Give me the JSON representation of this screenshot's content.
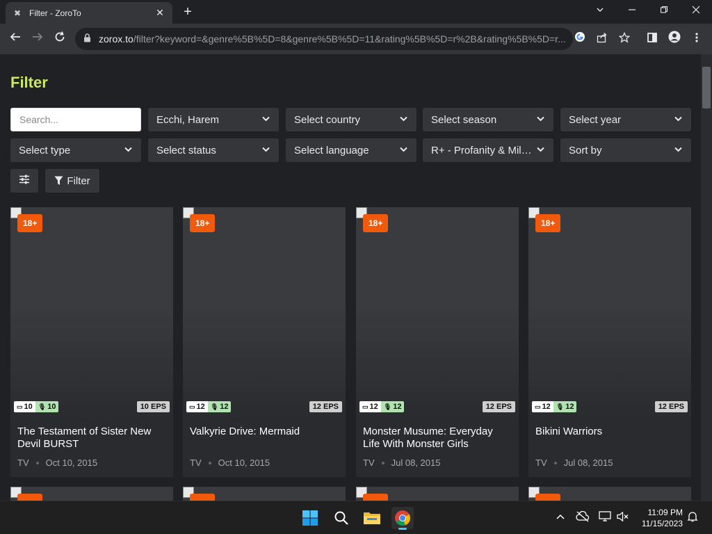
{
  "browser": {
    "tab_title": "Filter - ZoroTo",
    "tab_close": "✕",
    "new_tab": "+",
    "url_host": "zorox.to",
    "url_path": "/filter?keyword=&genre%5B%5D=8&genre%5B%5D=11&rating%5B%5D=r%2B&rating%5B%5D=r..."
  },
  "page": {
    "title": "Filter",
    "search_placeholder": "Search...",
    "filters_row1": [
      "Ecchi, Harem",
      "Select country",
      "Select season",
      "Select year"
    ],
    "filters_row2": [
      "Select type",
      "Select status",
      "Select language",
      "R+ - Profanity & Mild Nudity",
      "Sort by"
    ],
    "filter_button": "Filter"
  },
  "cards": [
    {
      "age": "18+",
      "sub": "10",
      "dub": "10",
      "eps": "10 EPS",
      "title": "The Testament of Sister New Devil BURST",
      "type": "TV",
      "date": "Oct 10, 2015"
    },
    {
      "age": "18+",
      "sub": "12",
      "dub": "12",
      "eps": "12 EPS",
      "title": "Valkyrie Drive: Mermaid",
      "type": "TV",
      "date": "Oct 10, 2015"
    },
    {
      "age": "18+",
      "sub": "12",
      "dub": "12",
      "eps": "12 EPS",
      "title": "Monster Musume: Everyday Life With Monster Girls",
      "type": "TV",
      "date": "Jul 08, 2015"
    },
    {
      "age": "18+",
      "sub": "12",
      "dub": "12",
      "eps": "12 EPS",
      "title": "Bikini Warriors",
      "type": "TV",
      "date": "Jul 08, 2015"
    }
  ],
  "taskbar": {
    "time": "11:09 PM",
    "date": "11/15/2023"
  },
  "colors": {
    "accent": "#cae962",
    "age_badge": "#f1590b",
    "dub_badge": "#b0e3af"
  }
}
